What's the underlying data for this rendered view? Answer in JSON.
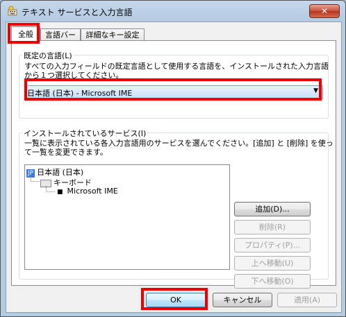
{
  "window": {
    "title": "テキスト サービスと入力言語",
    "close_label": "✕"
  },
  "tabs": [
    {
      "label": "全般",
      "selected": true
    },
    {
      "label": "言語バー",
      "selected": false
    },
    {
      "label": "詳細なキー設定",
      "selected": false
    }
  ],
  "default_language": {
    "group_title": "既定の言語(L)",
    "description_line1": "すべての入力フィールドの既定言語として使用する言語を、インストールされた入力言語",
    "description_line2": "から１つ選択してください。",
    "selected_value": "日本語 (日本) - Microsoft IME"
  },
  "installed_services": {
    "group_title": "インストールされているサービス(I)",
    "description_line1": "一覧に表示されている各入力言語用のサービスを選んでください。[追加] と [削除] を使っ",
    "description_line2": "て一覧を変更できます。",
    "tree": {
      "language_badge": "JP",
      "language": "日本語 (日本)",
      "category": "キーボード",
      "service": "Microsoft IME"
    }
  },
  "buttons": {
    "add": "追加(D)...",
    "remove": "削除(R)",
    "properties": "プロパティ(P)...",
    "move_up": "上へ移動(U)",
    "move_down": "下へ移動(O)",
    "ok": "OK",
    "cancel": "キャンセル",
    "apply": "適用(A)"
  },
  "colors": {
    "highlight": "#ee0000",
    "selection_badge": "#3b7be0"
  }
}
